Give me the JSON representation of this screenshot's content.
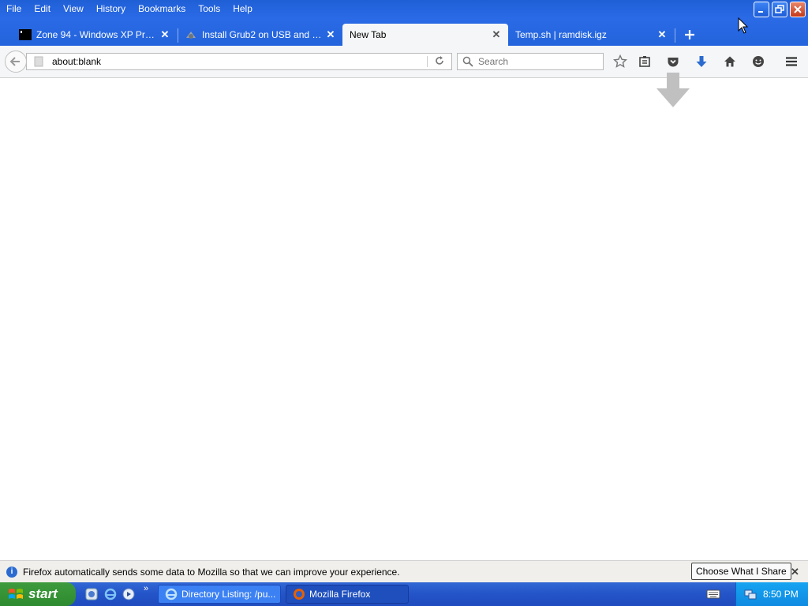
{
  "menu": [
    {
      "label": "File"
    },
    {
      "label": "Edit"
    },
    {
      "label": "View"
    },
    {
      "label": "History"
    },
    {
      "label": "Bookmarks"
    },
    {
      "label": "Tools"
    },
    {
      "label": "Help"
    }
  ],
  "tabs": [
    {
      "label": "Zone 94 - Windows XP Profes..."
    },
    {
      "label": "Install Grub2 on USB and HDD..."
    },
    {
      "label": "New Tab"
    },
    {
      "label": "Temp.sh | ramdisk.igz"
    }
  ],
  "navbar": {
    "url": "about:blank",
    "search_placeholder": "Search"
  },
  "notification": {
    "text": "Firefox automatically sends some data to Mozilla so that we can improve your experience.",
    "button_label": "Choose What I Share"
  },
  "taskbar": {
    "start_label": "start",
    "tasks": [
      {
        "label": "Directory Listing: /pu..."
      },
      {
        "label": "Mozilla Firefox"
      }
    ],
    "clock": "8:50 PM"
  },
  "icons": {
    "titlebar": [
      "minimize-icon",
      "maximize-icon",
      "close-icon"
    ],
    "navbar": [
      "back-arrow-icon",
      "reload-icon",
      "search-icon",
      "bookmark-star-icon",
      "reading-list-icon",
      "pocket-icon",
      "download-icon",
      "home-icon",
      "hello-icon",
      "hamburger-menu-icon"
    ]
  },
  "colors": {
    "titlebar": "#2364dc",
    "taskbar": "#2454c8",
    "start_button": "#2e8a2e",
    "tray": "#0f8ae2",
    "download_blue": "#2b6bd0"
  }
}
